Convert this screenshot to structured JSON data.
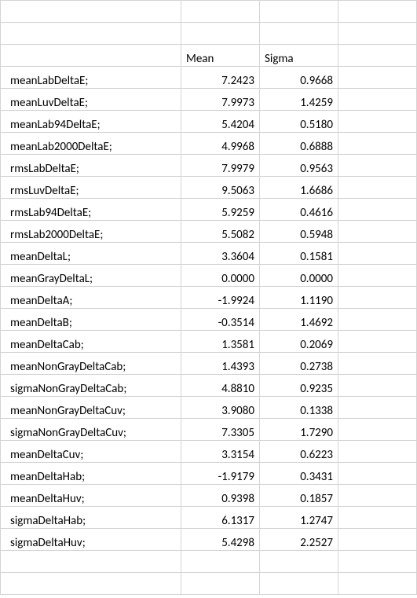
{
  "headers": {
    "col1": "Mean",
    "col2": "Sigma"
  },
  "rows": [
    {
      "label": "meanLabDeltaE;",
      "mean": "7.2423",
      "sigma": "0.9668"
    },
    {
      "label": "meanLuvDeltaE;",
      "mean": "7.9973",
      "sigma": "1.4259"
    },
    {
      "label": "meanLab94DeltaE;",
      "mean": "5.4204",
      "sigma": "0.5180"
    },
    {
      "label": "meanLab2000DeltaE;",
      "mean": "4.9968",
      "sigma": "0.6888"
    },
    {
      "label": "rmsLabDeltaE;",
      "mean": "7.9979",
      "sigma": "0.9563"
    },
    {
      "label": "rmsLuvDeltaE;",
      "mean": "9.5063",
      "sigma": "1.6686"
    },
    {
      "label": "rmsLab94DeltaE;",
      "mean": "5.9259",
      "sigma": "0.4616"
    },
    {
      "label": "rmsLab2000DeltaE;",
      "mean": "5.5082",
      "sigma": "0.5948"
    },
    {
      "label": "meanDeltaL;",
      "mean": "3.3604",
      "sigma": "0.1581"
    },
    {
      "label": "meanGrayDeltaL;",
      "mean": "0.0000",
      "sigma": "0.0000"
    },
    {
      "label": "meanDeltaA;",
      "mean": "-1.9924",
      "sigma": "1.1190"
    },
    {
      "label": "meanDeltaB;",
      "mean": "-0.3514",
      "sigma": "1.4692"
    },
    {
      "label": "meanDeltaCab;",
      "mean": "1.3581",
      "sigma": "0.2069"
    },
    {
      "label": "meanNonGrayDeltaCab;",
      "mean": "1.4393",
      "sigma": "0.2738"
    },
    {
      "label": "sigmaNonGrayDeltaCab;",
      "mean": "4.8810",
      "sigma": "0.9235"
    },
    {
      "label": "meanNonGrayDeltaCuv;",
      "mean": "3.9080",
      "sigma": "0.1338"
    },
    {
      "label": "sigmaNonGrayDeltaCuv;",
      "mean": "7.3305",
      "sigma": "1.7290"
    },
    {
      "label": "meanDeltaCuv;",
      "mean": "3.3154",
      "sigma": "0.6223"
    },
    {
      "label": "meanDeltaHab;",
      "mean": "-1.9179",
      "sigma": "0.3431"
    },
    {
      "label": "meanDeltaHuv;",
      "mean": "0.9398",
      "sigma": "0.1857"
    },
    {
      "label": "sigmaDeltaHab;",
      "mean": "6.1317",
      "sigma": "1.2747"
    },
    {
      "label": "sigmaDeltaHuv;",
      "mean": "5.4298",
      "sigma": "2.2527"
    }
  ]
}
